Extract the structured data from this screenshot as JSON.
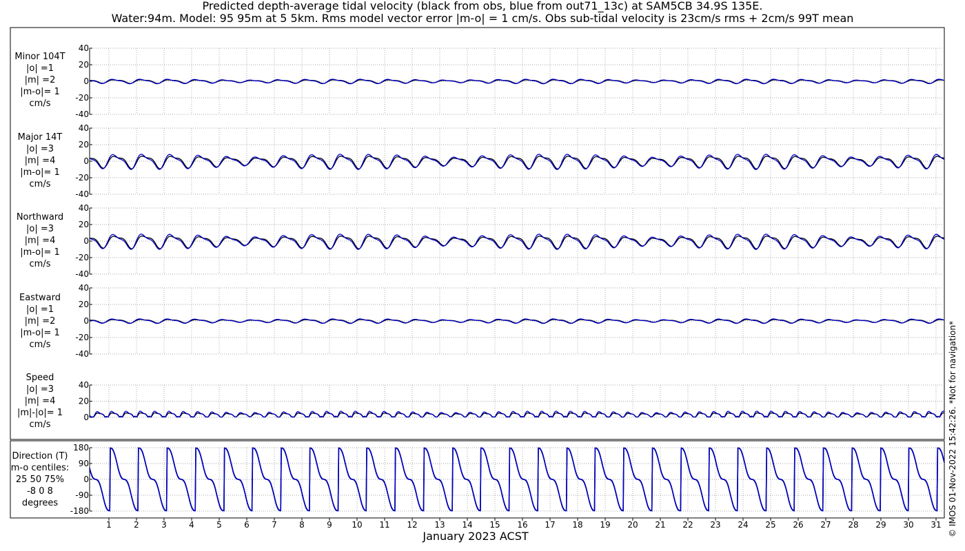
{
  "title_line1": "Predicted depth-average tidal velocity (black from obs, blue from out71_13c) at SAM5CB 34.9S 135E.",
  "title_line2": "Water:94m. Model: 95 95m at 5 5km. Rms model vector error |m-o| = 1 cm/s. Obs sub-tidal velocity is 23cm/s rms + 2cm/s 99T mean",
  "x_axis_label": "January 2023 ACST",
  "credit": "© IMOS 01-Nov-2022 15:42:26. *Not for navigation*",
  "colors": {
    "obs": "#000000",
    "model": "#0000cc",
    "grid": "#888888"
  },
  "chart_data": [
    {
      "type": "line",
      "label_lines": [
        "Minor 104T",
        "|o| =1",
        "|m| =2",
        "|m-o|= 1",
        "cm/s"
      ],
      "ylim": [
        -40,
        40
      ],
      "yticks": [
        "40",
        "20",
        "0",
        "-20",
        "-40"
      ],
      "xlim": [
        0.3,
        31.3
      ],
      "xticks": [
        "1",
        "2",
        "3",
        "4",
        "5",
        "6",
        "7",
        "8",
        "9",
        "10",
        "11",
        "12",
        "13",
        "14",
        "15",
        "16",
        "17",
        "18",
        "19",
        "20",
        "21",
        "22",
        "23",
        "24",
        "25",
        "26",
        "27",
        "28",
        "29",
        "30",
        "31"
      ],
      "series": [
        {
          "role": "obs",
          "amplitude": 2,
          "period_days": 1.0,
          "offset": 0
        },
        {
          "role": "model",
          "amplitude": 2.4,
          "period_days": 1.0,
          "offset": 0
        }
      ]
    },
    {
      "type": "line",
      "label_lines": [
        "Major 14T",
        "|o| =3",
        "|m| =4",
        "|m-o|= 1",
        "cm/s"
      ],
      "ylim": [
        -40,
        40
      ],
      "yticks": [
        "40",
        "20",
        "0",
        "-20",
        "-40"
      ],
      "xlim": [
        0.3,
        31.3
      ],
      "xticks": [
        "1",
        "2",
        "3",
        "4",
        "5",
        "6",
        "7",
        "8",
        "9",
        "10",
        "11",
        "12",
        "13",
        "14",
        "15",
        "16",
        "17",
        "18",
        "19",
        "20",
        "21",
        "22",
        "23",
        "24",
        "25",
        "26",
        "27",
        "28",
        "29",
        "30",
        "31"
      ],
      "series": [
        {
          "role": "obs",
          "amplitude": 7,
          "period_days": 1.03,
          "offset": 0
        },
        {
          "role": "model",
          "amplitude": 8,
          "period_days": 1.03,
          "offset": 0
        }
      ]
    },
    {
      "type": "line",
      "label_lines": [
        "Northward",
        "|o| =3",
        "|m| =4",
        "|m-o|= 1",
        "cm/s"
      ],
      "ylim": [
        -40,
        40
      ],
      "yticks": [
        "40",
        "20",
        "0",
        "-20",
        "-40"
      ],
      "xlim": [
        0.3,
        31.3
      ],
      "xticks": [
        "1",
        "2",
        "3",
        "4",
        "5",
        "6",
        "7",
        "8",
        "9",
        "10",
        "11",
        "12",
        "13",
        "14",
        "15",
        "16",
        "17",
        "18",
        "19",
        "20",
        "21",
        "22",
        "23",
        "24",
        "25",
        "26",
        "27",
        "28",
        "29",
        "30",
        "31"
      ],
      "series": [
        {
          "role": "obs",
          "amplitude": 7,
          "period_days": 1.03,
          "offset": 0
        },
        {
          "role": "model",
          "amplitude": 8,
          "period_days": 1.03,
          "offset": 0
        }
      ]
    },
    {
      "type": "line",
      "label_lines": [
        "Eastward",
        "|o| =1",
        "|m| =2",
        "|m-o|= 1",
        "cm/s"
      ],
      "ylim": [
        -40,
        40
      ],
      "yticks": [
        "40",
        "20",
        "0",
        "-20",
        "-40"
      ],
      "xlim": [
        0.3,
        31.3
      ],
      "xticks": [
        "1",
        "2",
        "3",
        "4",
        "5",
        "6",
        "7",
        "8",
        "9",
        "10",
        "11",
        "12",
        "13",
        "14",
        "15",
        "16",
        "17",
        "18",
        "19",
        "20",
        "21",
        "22",
        "23",
        "24",
        "25",
        "26",
        "27",
        "28",
        "29",
        "30",
        "31"
      ],
      "series": [
        {
          "role": "obs",
          "amplitude": 2,
          "period_days": 1.0,
          "offset": 0
        },
        {
          "role": "model",
          "amplitude": 2.4,
          "period_days": 1.0,
          "offset": 0
        }
      ]
    },
    {
      "type": "line",
      "label_lines": [
        "Speed",
        "|o| =3",
        "|m| =4",
        "|m|-|o|= 1",
        "cm/s"
      ],
      "ylim": [
        0,
        40
      ],
      "yticks": [
        "40",
        "20",
        "0"
      ],
      "xlim": [
        0.3,
        31.3
      ],
      "xticks": [
        "1",
        "2",
        "3",
        "4",
        "5",
        "6",
        "7",
        "8",
        "9",
        "10",
        "11",
        "12",
        "13",
        "14",
        "15",
        "16",
        "17",
        "18",
        "19",
        "20",
        "21",
        "22",
        "23",
        "24",
        "25",
        "26",
        "27",
        "28",
        "29",
        "30",
        "31"
      ],
      "series": [
        {
          "role": "obs",
          "amplitude": 3,
          "period_days": 0.52,
          "offset": 3
        },
        {
          "role": "model",
          "amplitude": 4,
          "period_days": 0.52,
          "offset": 3.5
        }
      ]
    },
    {
      "type": "line",
      "label_lines": [
        "Direction (T)",
        "m-o centiles:",
        "25  50  75%",
        "-8  0  8",
        "degrees"
      ],
      "ylim": [
        -180,
        180
      ],
      "yticks": [
        "180",
        "90",
        "0",
        "-90",
        "-180"
      ],
      "xlim": [
        0.3,
        31.3
      ],
      "xticks": [
        "1",
        "2",
        "3",
        "4",
        "5",
        "6",
        "7",
        "8",
        "9",
        "10",
        "11",
        "12",
        "13",
        "14",
        "15",
        "16",
        "17",
        "18",
        "19",
        "20",
        "21",
        "22",
        "23",
        "24",
        "25",
        "26",
        "27",
        "28",
        "29",
        "30",
        "31"
      ],
      "series": [
        {
          "role": "obs",
          "period_days": 1.035
        },
        {
          "role": "model",
          "period_days": 1.035
        }
      ]
    }
  ]
}
